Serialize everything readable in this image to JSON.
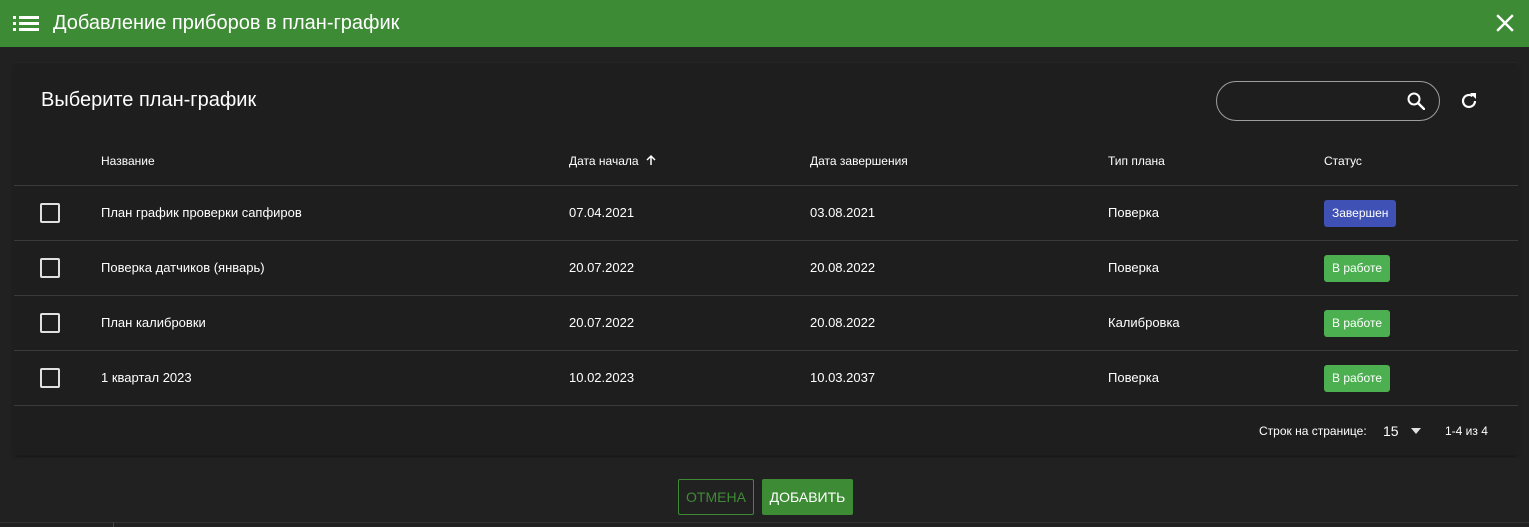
{
  "dialog": {
    "title": "Добавление приборов в план-график",
    "header_color": "#3e8b36"
  },
  "card": {
    "title": "Выберите план-график",
    "search": {
      "value": "",
      "placeholder": ""
    }
  },
  "table": {
    "columns": {
      "name": "Название",
      "start": "Дата начала",
      "end": "Дата завершения",
      "type": "Тип плана",
      "status": "Статус"
    },
    "sorted_column": "start",
    "sort_direction": "asc",
    "rows": [
      {
        "checked": false,
        "name": "План график проверки сапфиров",
        "start": "07.04.2021",
        "end": "03.08.2021",
        "type": "Поверка",
        "status": "Завершен",
        "status_color": "#3f51b5"
      },
      {
        "checked": false,
        "name": "Поверка датчиков (январь)",
        "start": "20.07.2022",
        "end": "20.08.2022",
        "type": "Поверка",
        "status": "В работе",
        "status_color": "#4caf50"
      },
      {
        "checked": false,
        "name": "План калибровки",
        "start": "20.07.2022",
        "end": "20.08.2022",
        "type": "Калибровка",
        "status": "В работе",
        "status_color": "#4caf50"
      },
      {
        "checked": false,
        "name": "1 квартал 2023",
        "start": "10.02.2023",
        "end": "10.03.2037",
        "type": "Поверка",
        "status": "В работе",
        "status_color": "#4caf50"
      }
    ]
  },
  "pagination": {
    "rows_per_page_label": "Строк на странице:",
    "rows_per_page": "15",
    "range": "1-4 из 4"
  },
  "actions": {
    "cancel_label": "Отмена",
    "add_label": "Добавить"
  },
  "icons": {
    "menu": "list-icon",
    "close": "close-icon",
    "search": "search-icon",
    "refresh": "refresh-icon",
    "sort": "arrow-up-icon",
    "rows_select": "chevron-down-icon"
  }
}
